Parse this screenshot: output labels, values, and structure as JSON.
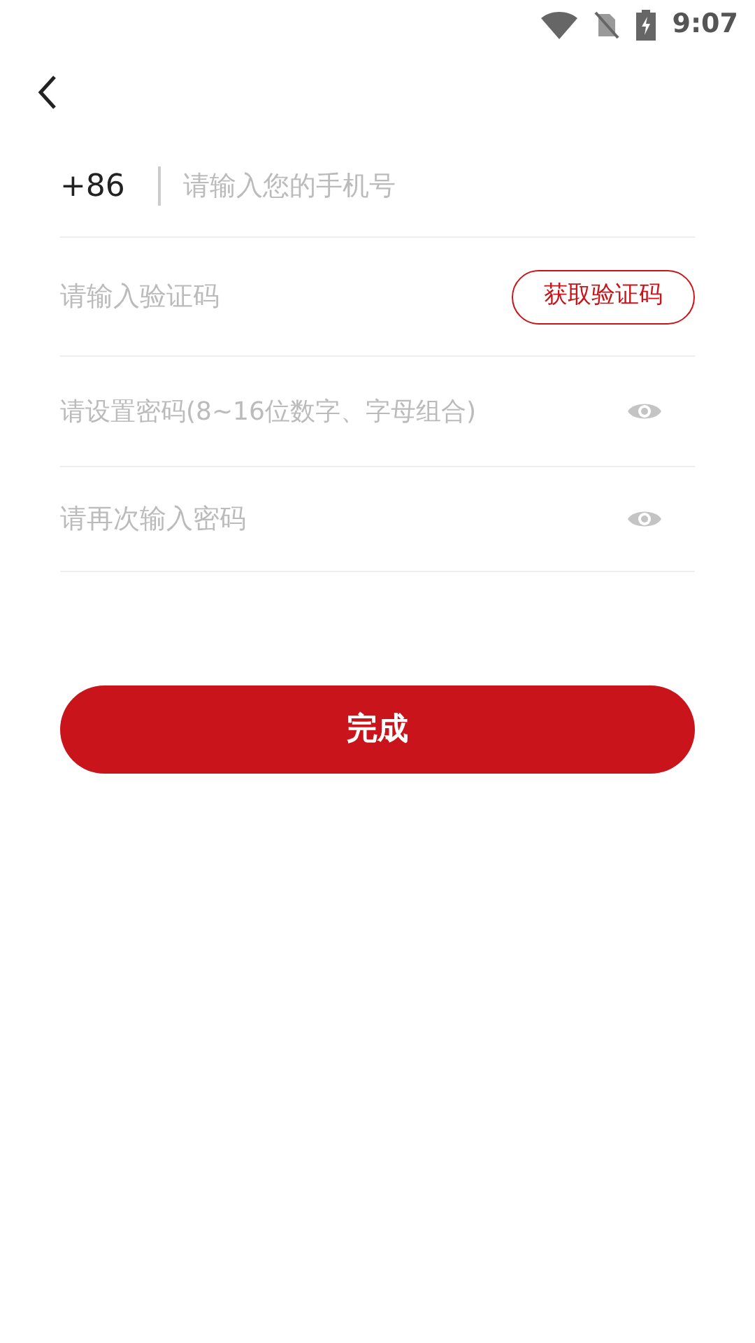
{
  "status_bar": {
    "time": "9:07"
  },
  "phone": {
    "country_code": "+86",
    "placeholder": "请输入您的手机号"
  },
  "code": {
    "placeholder": "请输入验证码",
    "button": "获取验证码"
  },
  "password": {
    "placeholder": "请设置密码(8~16位数字、字母组合)"
  },
  "confirm": {
    "placeholder": "请再次输入密码"
  },
  "submit": "完成"
}
